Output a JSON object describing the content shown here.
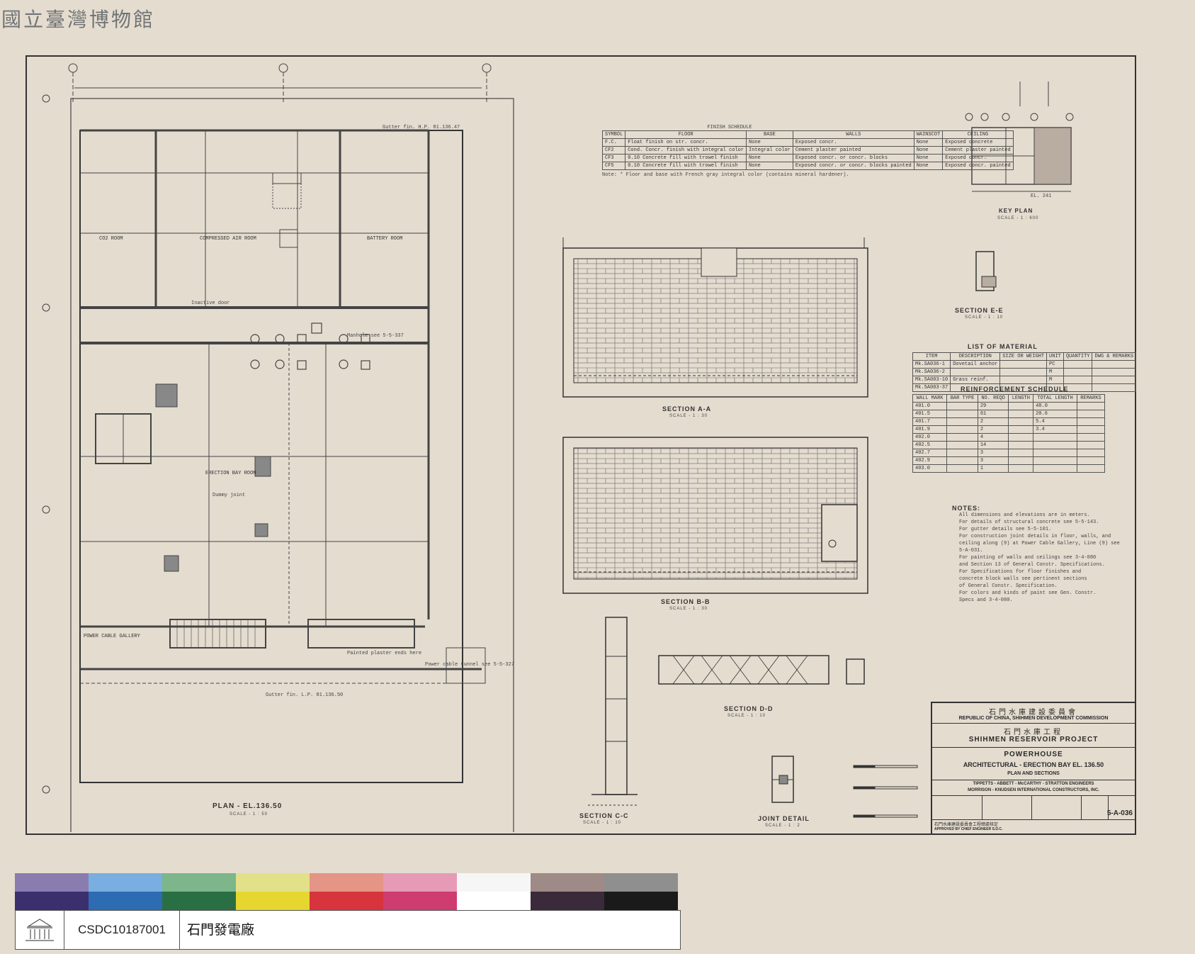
{
  "watermark": "國立臺灣博物館",
  "plan": {
    "title": "PLAN - EL.136.50",
    "scale": "SCALE - 1 : 50",
    "rooms": [
      "CO2 ROOM",
      "COMPRESSED AIR ROOM",
      "BATTERY ROOM",
      "ERECTION BAY ROOM",
      "POWER CABLE GALLERY"
    ],
    "notes": [
      "Gutter fin. H.P. 81.136.47",
      "Manhole see 5-5-337",
      "Inactive door",
      "Dummy joint",
      "Power cable tunnel see 5-5-327",
      "Painted plaster ends here",
      "Gutter fin. L.P. 81.136.50"
    ]
  },
  "finish_schedule": {
    "title": "FINISH SCHEDULE",
    "headers": [
      "SYMBOL",
      "FLOOR",
      "BASE",
      "WALLS",
      "WAINSCOT",
      "CEILING"
    ],
    "rows": [
      [
        "F.C.",
        "Float finish on str. concr.",
        "None",
        "Exposed concr.",
        "None",
        "Exposed concrete"
      ],
      [
        "CF2",
        "Cond. Concr. finish with integral color",
        "Integral color",
        "Cement plaster painted",
        "None",
        "Cement plaster painted"
      ],
      [
        "CF3",
        "0.10 Concrete fill with trowel finish",
        "None",
        "Exposed concr. or concr. blocks",
        "None",
        "Exposed concr."
      ],
      [
        "CF5",
        "0.10 Concrete fill with trowel finish",
        "None",
        "Exposed concr. or concr. blocks painted",
        "None",
        "Exposed concr. painted"
      ]
    ],
    "note": "Note: * Floor and base with French gray integral color (contains mineral hardener)."
  },
  "key_plan": {
    "title": "KEY PLAN",
    "scale": "SCALE - 1 : 600",
    "label": "EL. 241"
  },
  "sections": [
    {
      "title": "SECTION A-A",
      "scale": "SCALE - 1 : 30"
    },
    {
      "title": "SECTION B-B",
      "scale": "SCALE - 1 : 30"
    },
    {
      "title": "SECTION C-C",
      "scale": "SCALE - 1 : 10"
    },
    {
      "title": "SECTION D-D",
      "scale": "SCALE - 1 : 10"
    },
    {
      "title": "SECTION E-E",
      "scale": "SCALE - 1 : 10"
    },
    {
      "title": "JOINT DETAIL",
      "scale": "SCALE - 1 : 2"
    }
  ],
  "list_of_material": {
    "title": "LIST OF MATERIAL",
    "headers": [
      "ITEM",
      "DESCRIPTION",
      "SIZE OR WEIGHT",
      "UNIT",
      "QUANTITY",
      "DWG & REMARKS"
    ],
    "rows": [
      [
        "Mk.SA036-1",
        "Dovetail anchor",
        "",
        "PC",
        "",
        ""
      ],
      [
        "Mk.SA036-2",
        "",
        "",
        "M",
        "",
        ""
      ],
      [
        "Mk.5A003-10",
        "Grass reinf.",
        "",
        "M",
        "",
        ""
      ],
      [
        "Mk.5A003-37",
        "",
        "",
        "",
        "",
        ""
      ]
    ]
  },
  "reinforcement_schedule": {
    "title": "REINFORCEMENT SCHEDULE",
    "headers": [
      "WALL MARK",
      "BAR TYPE",
      "NO. REQD",
      "LENGTH",
      "TOTAL LENGTH",
      "REMARKS"
    ],
    "rows": [
      [
        "401.0",
        "",
        "29",
        "",
        "48.0",
        ""
      ],
      [
        "401.5",
        "",
        "61",
        "",
        "20.6",
        ""
      ],
      [
        "401.7",
        "",
        "2",
        "",
        "5.4",
        ""
      ],
      [
        "401.9",
        "",
        "2",
        "",
        "3.4",
        ""
      ],
      [
        "402.0",
        "",
        "4",
        "",
        "",
        ""
      ],
      [
        "402.5",
        "",
        "14",
        "",
        "",
        ""
      ],
      [
        "402.7",
        "",
        "3",
        "",
        "",
        ""
      ],
      [
        "402.9",
        "",
        "3",
        "",
        "",
        ""
      ],
      [
        "403.0",
        "",
        "1",
        "",
        "",
        ""
      ]
    ]
  },
  "notes_block": {
    "title": "NOTES:",
    "lines": [
      "All dimensions and elevations are in meters.",
      "For details of structural concrete see 5-5-143.",
      "For gutter details see 5-5-101.",
      "For construction joint details in floor, walls, and",
      "ceiling along (9) at Power Cable Gallery, Line (9) see",
      "5-A-031.",
      "For painting of walls and ceilings see 3-4-080",
      "and Section 13 of General Constr. Specifications.",
      "For Specifications for floor finishes and",
      "concrete block walls see pertinent sections",
      "of General Constr. Specification.",
      "For colors and kinds of paint see Gen. Constr.",
      "Specs and 3-4-080."
    ]
  },
  "title_block": {
    "commission_cn": "石門水庫建設委員會",
    "commission_en": "REPUBLIC OF CHINA, SHIHMEN DEVELOPMENT COMMISSION",
    "project_cn": "石門水庫工程",
    "project_en": "SHIHMEN RESERVOIR PROJECT",
    "building": "POWERHOUSE",
    "subtitle": "ARCHITECTURAL - ERECTION BAY EL. 136.50",
    "sheet_title": "PLAN AND SECTIONS",
    "firm1": "TIPPETTS - ABBETT - McCARTHY - STRATTON ENGINEERS",
    "firm2": "MORRISON - KNUDSEN INTERNATIONAL CONSTRUCTORS, INC.",
    "dwg_no": "5-A-036",
    "approved_cn": "石門水庫建設委員會工程總處核定",
    "approved_en": "APPROVED BY CHIEF ENGINEER S.D.C."
  },
  "color_chart": [
    "#8b7cb0",
    "#78aee0",
    "#7cb68a",
    "#e3e08a",
    "#e59585",
    "#e79ab5",
    "#f6f6f6",
    "#9e8a86",
    "#8f8f8f"
  ],
  "color_chart_dark": [
    "#3c2f6e",
    "#2d6bb2",
    "#2a6f43",
    "#e5d72f",
    "#d7343e",
    "#cf3c6f",
    "#ffffff",
    "#3a2a3a",
    "#1a1a1a"
  ],
  "caption": {
    "code": "CSDC10187001",
    "name": "石門發電廠"
  }
}
